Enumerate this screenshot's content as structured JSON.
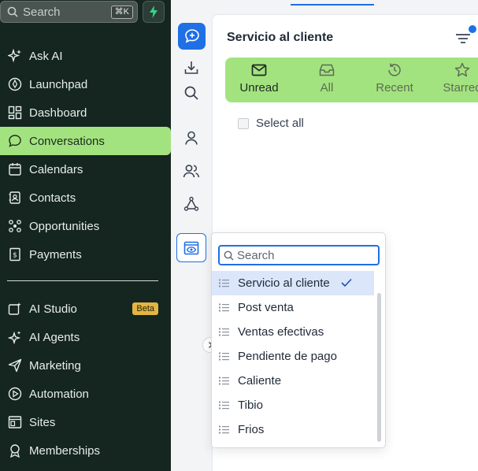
{
  "sidebar": {
    "search_placeholder": "Search",
    "search_shortcut": "⌘K",
    "items": [
      {
        "label": "Ask AI",
        "icon": "sparkle-icon"
      },
      {
        "label": "Launchpad",
        "icon": "rocket-icon"
      },
      {
        "label": "Dashboard",
        "icon": "dashboard-icon"
      },
      {
        "label": "Conversations",
        "icon": "chat-bubble-icon",
        "active": true
      },
      {
        "label": "Calendars",
        "icon": "calendar-icon"
      },
      {
        "label": "Contacts",
        "icon": "contacts-icon"
      },
      {
        "label": "Opportunities",
        "icon": "opportunities-icon"
      },
      {
        "label": "Payments",
        "icon": "payments-icon"
      }
    ],
    "items2": [
      {
        "label": "AI Studio",
        "icon": "ai-studio-icon",
        "badge": "Beta"
      },
      {
        "label": "AI Agents",
        "icon": "ai-agents-icon"
      },
      {
        "label": "Marketing",
        "icon": "send-icon"
      },
      {
        "label": "Automation",
        "icon": "automation-icon"
      },
      {
        "label": "Sites",
        "icon": "sites-icon"
      },
      {
        "label": "Memberships",
        "icon": "memberships-icon"
      }
    ]
  },
  "panel": {
    "title": "Servicio al cliente",
    "tabs": [
      {
        "label": "Unread",
        "icon": "mail-icon",
        "active": true
      },
      {
        "label": "All",
        "icon": "inbox-icon"
      },
      {
        "label": "Recent",
        "icon": "history-icon"
      },
      {
        "label": "Starred",
        "icon": "star-icon"
      }
    ],
    "select_all": "Select all"
  },
  "dropdown": {
    "search_placeholder": "Search",
    "items": [
      {
        "label": "Servicio al cliente",
        "selected": true
      },
      {
        "label": "Post venta"
      },
      {
        "label": "Ventas efectivas"
      },
      {
        "label": "Pendiente de pago"
      },
      {
        "label": "Caliente"
      },
      {
        "label": "Tibio"
      },
      {
        "label": "Frios"
      }
    ]
  },
  "colors": {
    "sidebar_bg": "#14261f",
    "accent_green": "#a3e37f",
    "accent_blue": "#1f6fe5",
    "beta_badge": "#e3b542"
  }
}
